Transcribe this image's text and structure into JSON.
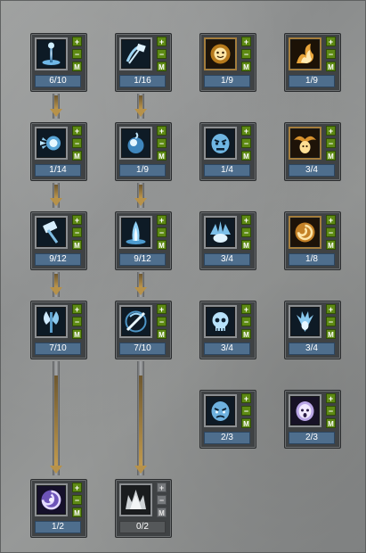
{
  "skill_tree": {
    "skills": [
      {
        "id": "s1",
        "icon": "staff-icon",
        "theme": "blue",
        "level": "6/10",
        "maxed_enabled": true
      },
      {
        "id": "s2",
        "icon": "hammer-swing-icon",
        "theme": "blue",
        "level": "1/16",
        "maxed_enabled": true
      },
      {
        "id": "s3",
        "icon": "radiant-face-icon",
        "theme": "gold",
        "level": "1/9",
        "maxed_enabled": true
      },
      {
        "id": "s4",
        "icon": "flame-rider-icon",
        "theme": "gold",
        "level": "1/9",
        "maxed_enabled": true
      },
      {
        "id": "s5",
        "icon": "burst-fist-icon",
        "theme": "blue",
        "level": "1/14",
        "maxed_enabled": true
      },
      {
        "id": "s6",
        "icon": "orb-icon",
        "theme": "blue",
        "level": "1/9",
        "maxed_enabled": true
      },
      {
        "id": "s7",
        "icon": "angry-mask-icon",
        "theme": "blue",
        "level": "1/4",
        "maxed_enabled": true
      },
      {
        "id": "s8",
        "icon": "winged-face-icon",
        "theme": "gold",
        "level": "3/4",
        "maxed_enabled": true
      },
      {
        "id": "s9",
        "icon": "hammer-icon",
        "theme": "blue",
        "level": "9/12",
        "maxed_enabled": true
      },
      {
        "id": "s10",
        "icon": "flame-pillar-icon",
        "theme": "blue",
        "level": "9/12",
        "maxed_enabled": true
      },
      {
        "id": "s11",
        "icon": "splash-icon",
        "theme": "blue",
        "level": "3/4",
        "maxed_enabled": true
      },
      {
        "id": "s12",
        "icon": "swirl-icon",
        "theme": "gold",
        "level": "1/8",
        "maxed_enabled": true
      },
      {
        "id": "s13",
        "icon": "axe-icon",
        "theme": "blue",
        "level": "7/10",
        "maxed_enabled": true
      },
      {
        "id": "s14",
        "icon": "slash-icon",
        "theme": "blue",
        "level": "7/10",
        "maxed_enabled": true
      },
      {
        "id": "s15",
        "icon": "skull-icon",
        "theme": "blue",
        "level": "3/4",
        "maxed_enabled": true
      },
      {
        "id": "s16",
        "icon": "feather-crest-icon",
        "theme": "blue",
        "level": "3/4",
        "maxed_enabled": true
      },
      {
        "id": "s17",
        "icon": "grim-face-icon",
        "theme": "blue",
        "level": "2/3",
        "maxed_enabled": true
      },
      {
        "id": "s18",
        "icon": "spirit-face-icon",
        "theme": "violet",
        "level": "2/3",
        "maxed_enabled": true
      },
      {
        "id": "s19",
        "icon": "vortex-icon",
        "theme": "violet",
        "level": "1/2",
        "maxed_enabled": true
      },
      {
        "id": "s20",
        "icon": "crown-spikes-icon",
        "theme": "grey",
        "level": "0/2",
        "maxed_enabled": false
      }
    ],
    "buttons": {
      "plus": "+",
      "minus": "−",
      "master": "M"
    },
    "colors": {
      "level_bar": "#4e6e8d",
      "button_active": "#5e8a14",
      "button_disabled": "#76797c",
      "arrow": "#b7924a"
    }
  }
}
